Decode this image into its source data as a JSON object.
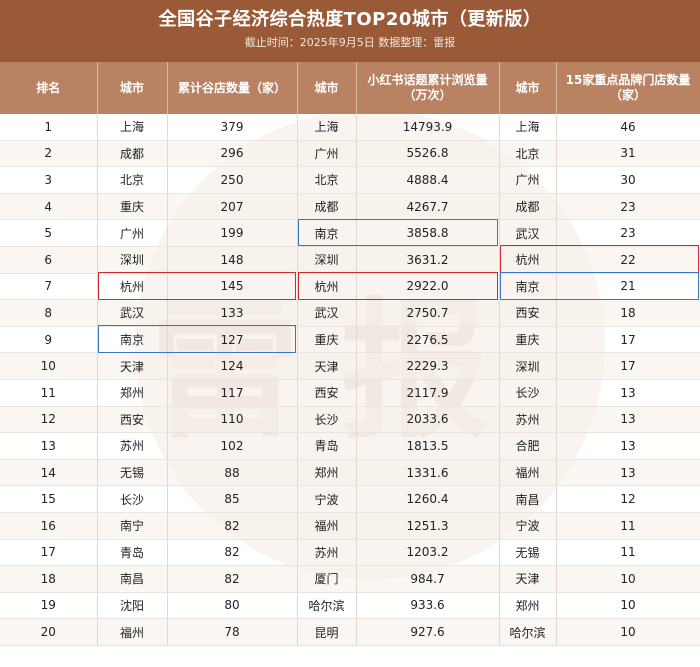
{
  "title": "全国谷子经济综合热度TOP20城市（更新版）",
  "subtitle": "截止时间：2025年9月5日 数据整理：雷报",
  "headers": {
    "rank": "排名",
    "city1": "城市",
    "stores": "累计谷店数量（家）",
    "city2": "城市",
    "views": "小红书话题累计浏览量（万次）",
    "city3": "城市",
    "brands": "15家重点品牌门店数量（家）"
  },
  "rows": [
    {
      "rank": "1",
      "city1": "上海",
      "stores": "379",
      "city2": "上海",
      "views": "14793.9",
      "city3": "上海",
      "brands": "46"
    },
    {
      "rank": "2",
      "city1": "成都",
      "stores": "296",
      "city2": "广州",
      "views": "5526.8",
      "city3": "北京",
      "brands": "31"
    },
    {
      "rank": "3",
      "city1": "北京",
      "stores": "250",
      "city2": "北京",
      "views": "4888.4",
      "city3": "广州",
      "brands": "30"
    },
    {
      "rank": "4",
      "city1": "重庆",
      "stores": "207",
      "city2": "成都",
      "views": "4267.7",
      "city3": "成都",
      "brands": "23"
    },
    {
      "rank": "5",
      "city1": "广州",
      "stores": "199",
      "city2": "南京",
      "views": "3858.8",
      "city3": "武汉",
      "brands": "23"
    },
    {
      "rank": "6",
      "city1": "深圳",
      "stores": "148",
      "city2": "深圳",
      "views": "3631.2",
      "city3": "杭州",
      "brands": "22"
    },
    {
      "rank": "7",
      "city1": "杭州",
      "stores": "145",
      "city2": "杭州",
      "views": "2922.0",
      "city3": "南京",
      "brands": "21"
    },
    {
      "rank": "8",
      "city1": "武汉",
      "stores": "133",
      "city2": "武汉",
      "views": "2750.7",
      "city3": "西安",
      "brands": "18"
    },
    {
      "rank": "9",
      "city1": "南京",
      "stores": "127",
      "city2": "重庆",
      "views": "2276.5",
      "city3": "重庆",
      "brands": "17"
    },
    {
      "rank": "10",
      "city1": "天津",
      "stores": "124",
      "city2": "天津",
      "views": "2229.3",
      "city3": "深圳",
      "brands": "17"
    },
    {
      "rank": "11",
      "city1": "郑州",
      "stores": "117",
      "city2": "西安",
      "views": "2117.9",
      "city3": "长沙",
      "brands": "13"
    },
    {
      "rank": "12",
      "city1": "西安",
      "stores": "110",
      "city2": "长沙",
      "views": "2033.6",
      "city3": "苏州",
      "brands": "13"
    },
    {
      "rank": "13",
      "city1": "苏州",
      "stores": "102",
      "city2": "青岛",
      "views": "1813.5",
      "city3": "合肥",
      "brands": "13"
    },
    {
      "rank": "14",
      "city1": "无锡",
      "stores": "88",
      "city2": "郑州",
      "views": "1331.6",
      "city3": "福州",
      "brands": "13"
    },
    {
      "rank": "15",
      "city1": "长沙",
      "stores": "85",
      "city2": "宁波",
      "views": "1260.4",
      "city3": "南昌",
      "brands": "12"
    },
    {
      "rank": "16",
      "city1": "南宁",
      "stores": "82",
      "city2": "福州",
      "views": "1251.3",
      "city3": "宁波",
      "brands": "11"
    },
    {
      "rank": "17",
      "city1": "青岛",
      "stores": "82",
      "city2": "苏州",
      "views": "1203.2",
      "city3": "无锡",
      "brands": "11"
    },
    {
      "rank": "18",
      "city1": "南昌",
      "stores": "82",
      "city2": "厦门",
      "views": "984.7",
      "city3": "天津",
      "brands": "10"
    },
    {
      "rank": "19",
      "city1": "沈阳",
      "stores": "80",
      "city2": "哈尔滨",
      "views": "933.6",
      "city3": "郑州",
      "brands": "10"
    },
    {
      "rank": "20",
      "city1": "福州",
      "stores": "78",
      "city2": "昆明",
      "views": "927.6",
      "city3": "哈尔滨",
      "brands": "10"
    }
  ],
  "highlights": [
    {
      "color": "red",
      "section": "stores",
      "row": 7
    },
    {
      "color": "blue",
      "section": "stores",
      "row": 9
    },
    {
      "color": "blue",
      "section": "views",
      "row": 5
    },
    {
      "color": "red",
      "section": "views",
      "row": 7
    },
    {
      "color": "red",
      "section": "brands",
      "row": 6
    },
    {
      "color": "blue",
      "section": "brands",
      "row": 7
    }
  ],
  "colors": {
    "header_bg": "#9a5a38",
    "column_header_bg": "#b98262",
    "highlight_red": "#d22a2a",
    "highlight_blue": "#3b73c8"
  }
}
